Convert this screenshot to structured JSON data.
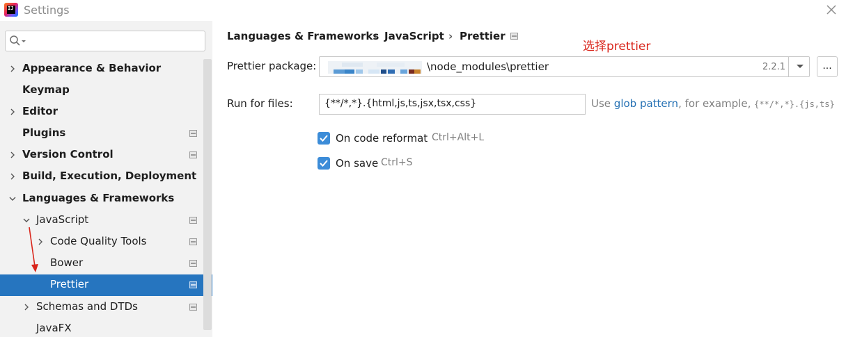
{
  "window": {
    "title": "Settings"
  },
  "search": {
    "placeholder": ""
  },
  "tree": [
    {
      "label": "Appearance & Behavior",
      "bold": true,
      "expandable": true,
      "expanded": false,
      "project": false
    },
    {
      "label": "Keymap",
      "bold": true,
      "expandable": false,
      "project": false
    },
    {
      "label": "Editor",
      "bold": true,
      "expandable": true,
      "expanded": false,
      "project": false
    },
    {
      "label": "Plugins",
      "bold": true,
      "expandable": false,
      "project": true
    },
    {
      "label": "Version Control",
      "bold": true,
      "expandable": true,
      "expanded": false,
      "project": true
    },
    {
      "label": "Build, Execution, Deployment",
      "bold": true,
      "expandable": true,
      "expanded": false,
      "project": false
    },
    {
      "label": "Languages & Frameworks",
      "bold": true,
      "expandable": true,
      "expanded": true,
      "project": false
    },
    {
      "label": "JavaScript",
      "bold": false,
      "expandable": true,
      "expanded": true,
      "project": true
    },
    {
      "label": "Code Quality Tools",
      "bold": false,
      "expandable": true,
      "expanded": false,
      "project": true
    },
    {
      "label": "Bower",
      "bold": false,
      "expandable": false,
      "project": true
    },
    {
      "label": "Prettier",
      "bold": false,
      "expandable": false,
      "project": true,
      "selected": true
    },
    {
      "label": "Schemas and DTDs",
      "bold": false,
      "expandable": true,
      "expanded": false,
      "project": true
    },
    {
      "label": "JavaFX",
      "bold": false,
      "expandable": false,
      "project": false
    }
  ],
  "breadcrumb": {
    "items": [
      "Languages & Frameworks",
      "JavaScript",
      "Prettier"
    ],
    "separator": "›"
  },
  "annotation": {
    "text": "选择prettier"
  },
  "prettier": {
    "package_label": "Prettier package:",
    "package_path": "\\node_modules\\prettier",
    "package_version": "2.2.1",
    "browse_label": "...",
    "run_label": "Run for files:",
    "run_value": "{**/*,*}.{html,js,ts,jsx,tsx,css}",
    "hint_prefix": "Use ",
    "hint_link": "glob pattern",
    "hint_middle": ", for example, ",
    "hint_example": "{**/*,*}.{js,ts}",
    "on_reformat_label": "On code reformat",
    "on_reformat_shortcut": "Ctrl+Alt+L",
    "on_reformat_checked": true,
    "on_save_label": "On save",
    "on_save_shortcut": "Ctrl+S",
    "on_save_checked": true
  },
  "colors": {
    "selection": "#2675bf",
    "checkbox": "#3c8cd8",
    "link": "#2470b3",
    "annotation": "#d9261c"
  }
}
